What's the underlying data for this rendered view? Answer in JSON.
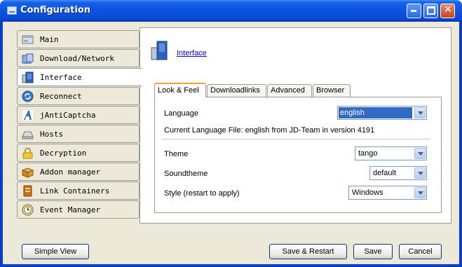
{
  "window": {
    "title": "Configuration"
  },
  "sidebar": {
    "items": [
      {
        "label": "Main",
        "icon": "main-icon",
        "selected": false
      },
      {
        "label": "Download/Network",
        "icon": "download-network-icon",
        "selected": false
      },
      {
        "label": "Interface",
        "icon": "interface-icon",
        "selected": true
      },
      {
        "label": "Reconnect",
        "icon": "reconnect-icon",
        "selected": false
      },
      {
        "label": "jAntiCaptcha",
        "icon": "anticaptcha-icon",
        "selected": false
      },
      {
        "label": "Hosts",
        "icon": "hosts-icon",
        "selected": false
      },
      {
        "label": "Decryption",
        "icon": "decryption-lock-icon",
        "selected": false
      },
      {
        "label": "Addon manager",
        "icon": "addon-box-icon",
        "selected": false
      },
      {
        "label": "Link Containers",
        "icon": "link-container-icon",
        "selected": false
      },
      {
        "label": "Event Manager",
        "icon": "event-manager-icon",
        "selected": false
      }
    ]
  },
  "main": {
    "header_link": "Interface",
    "tabs": [
      {
        "label": "Look & Feel",
        "active": true
      },
      {
        "label": "Downloadlinks",
        "active": false
      },
      {
        "label": "Advanced",
        "active": false
      },
      {
        "label": "Browser",
        "active": false
      }
    ],
    "language": {
      "label": "Language",
      "value": "english"
    },
    "current_language_file": "Current Language File: english from JD-Team in version 4191",
    "theme": {
      "label": "Theme",
      "value": "tango"
    },
    "soundtheme": {
      "label": "Soundtheme",
      "value": "default"
    },
    "style": {
      "label": "Style (restart to apply)",
      "value": "Windows"
    }
  },
  "footer": {
    "simple_view": "Simple View",
    "save_restart": "Save & Restart",
    "save": "Save",
    "cancel": "Cancel"
  },
  "colors": {
    "titlebar": "#0a4ad4",
    "client_bg": "#ece9d8",
    "selection": "#316ac5",
    "active_tab_accent": "#f7a12c",
    "link": "#0000ee"
  }
}
